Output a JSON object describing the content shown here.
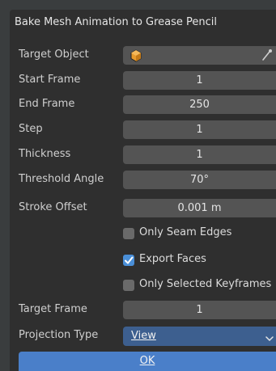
{
  "dialog": {
    "title": "Bake Mesh Animation to Grease Pencil",
    "fields": {
      "target_object": {
        "label": "Target Object",
        "value": ""
      },
      "start_frame": {
        "label": "Start Frame",
        "value": "1"
      },
      "end_frame": {
        "label": "End Frame",
        "value": "250"
      },
      "step": {
        "label": "Step",
        "value": "1"
      },
      "thickness": {
        "label": "Thickness",
        "value": "1"
      },
      "threshold_angle": {
        "label": "Threshold Angle",
        "value": "70°"
      },
      "stroke_offset": {
        "label": "Stroke Offset",
        "value": "0.001 m"
      },
      "target_frame": {
        "label": "Target Frame",
        "value": "1"
      },
      "projection_type": {
        "label": "Projection Type",
        "value": "View"
      }
    },
    "checkboxes": {
      "only_seam_edges": {
        "label": "Only Seam Edges",
        "checked": false
      },
      "export_faces": {
        "label": "Export Faces",
        "checked": true
      },
      "only_selected_keyframes": {
        "label": "Only Selected Keyframes",
        "checked": false
      }
    },
    "ok_label": "OK"
  },
  "colors": {
    "accent": "#4a8fd8",
    "ok_button": "#4a7fc9",
    "dropdown": "#3d5f8f",
    "field": "#545454",
    "panel": "#2f2f2f"
  },
  "icons": {
    "target_object": "object-cube-icon",
    "eyedropper": "eyedropper-icon",
    "dropdown": "chevron-down-icon",
    "check": "checkmark-icon"
  }
}
